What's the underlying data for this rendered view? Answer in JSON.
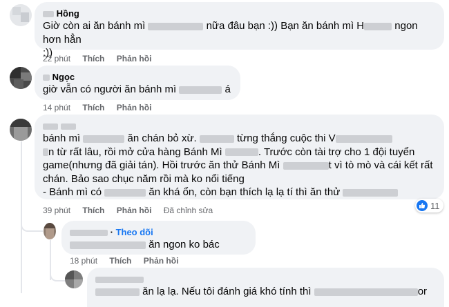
{
  "comments": [
    {
      "author": "Hồng",
      "text_1": "Giờ còn ai ăn bánh mì",
      "text_2": "nữa đâu bạn :)) Bạn ăn bánh mì H",
      "text_3": "ngon hơn hẳn",
      "text_4": ":))",
      "time": "22 phút",
      "like": "Thích",
      "reply": "Phản hồi"
    },
    {
      "author": "Ngọc",
      "text_1": "giờ vẫn có người ăn bánh mì",
      "text_2": "á",
      "time": "14 phút",
      "like": "Thích",
      "reply": "Phản hồi"
    },
    {
      "line_1a": "bánh mì",
      "line_1b": "ăn chán bỏ xừ.",
      "line_1c": "từng thắng cuộc thi V",
      "line_2a": "n từ rất lâu, rồi mở cửa hàng Bánh Mì",
      "line_2b": ". Trước còn tài trợ cho 1 đội tuyển",
      "line_3a": "game(nhưng đã giải tán). Hồi trước ăn thử Bánh Mì",
      "line_3b": "t vì tò mò và cái kết rất",
      "line_4": "chán. Bảo sao chục năm rồi mà ko nổi tiếng",
      "line_5a": "- Bánh mì có",
      "line_5b": "ăn khá ổn, còn bạn thích lạ lạ tí thì ăn thử",
      "time": "39 phút",
      "like": "Thích",
      "reply": "Phản hồi",
      "edited": "Đã chỉnh sửa",
      "reaction_count": "11"
    },
    {
      "follow": "Theo dõi",
      "text": "ăn ngon ko bác",
      "time": "18 phút",
      "like": "Thích",
      "reply": "Phản hồi"
    },
    {
      "text_1": "ăn lạ lạ. Nếu tôi đánh giá khó tính thì",
      "text_2": "or"
    }
  ],
  "colors": {
    "bubble": "#f0f2f5",
    "meta": "#65676b",
    "link": "#1877f2",
    "like_icon": "#1877f2"
  },
  "icons": [
    "thumbs-up-icon"
  ]
}
